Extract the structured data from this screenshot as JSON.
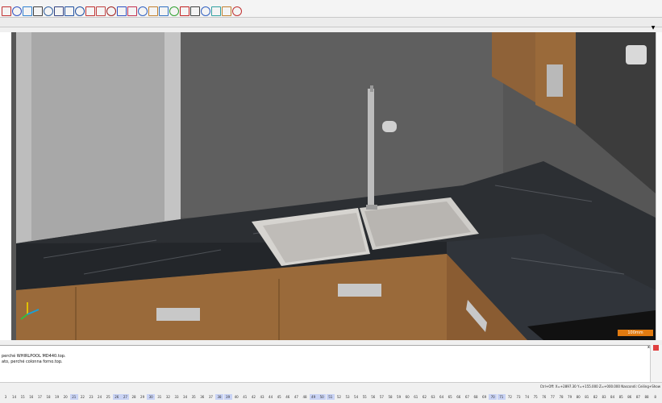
{
  "toolbar": {
    "icons": [
      "line-icon",
      "target-icon",
      "ellipse-icon",
      "layers-icon",
      "cube-icon",
      "cylinder-icon",
      "sphere-icon",
      "globe-icon",
      "arc-icon",
      "curve-icon",
      "spline-icon",
      "offset-icon",
      "arch-icon",
      "steps-icon",
      "bend-icon",
      "move-icon",
      "copy-icon",
      "erase-icon",
      "mirror-icon",
      "scale-icon",
      "measure-icon",
      "rotate-icon",
      "text-icon"
    ]
  },
  "command_panel": {
    "lines": [
      "perché WHIRLPOOL MD440.top.",
      "ato, perché colonna forno.top."
    ]
  },
  "status": {
    "coords": "Ctrl+Off: X=+2897.30  Y=+155.000  Z=+000.000  Nascondi: Ceiling+Show"
  },
  "bottom_numbers": [
    "3",
    "14",
    "15",
    "16",
    "17",
    "18",
    "19",
    "20",
    "21",
    "22",
    "23",
    "24",
    "25",
    "26",
    "27",
    "28",
    "29",
    "30",
    "31",
    "32",
    "33",
    "34",
    "35",
    "36",
    "37",
    "38",
    "39",
    "40",
    "41",
    "42",
    "43",
    "44",
    "45",
    "46",
    "47",
    "48",
    "49",
    "50",
    "51",
    "52",
    "53",
    "54",
    "55",
    "56",
    "57",
    "58",
    "59",
    "60",
    "61",
    "62",
    "63",
    "64",
    "65",
    "66",
    "67",
    "68",
    "69",
    "70",
    "71",
    "72",
    "73",
    "74",
    "75",
    "76",
    "77",
    "78",
    "79",
    "80",
    "81",
    "82",
    "83",
    "84",
    "85",
    "86",
    "87",
    "88",
    "8"
  ],
  "highlighted_numbers": [
    "21",
    "26",
    "27",
    "30",
    "38",
    "39",
    "49",
    "50",
    "51",
    "70",
    "71"
  ],
  "scale_label": "100mm",
  "colors": {
    "wall": "#5a5a5a",
    "countertop": "#2c2f33",
    "wood": "#9a6a3a",
    "sink": "#d8d6d2",
    "accent": "#e07a10"
  }
}
